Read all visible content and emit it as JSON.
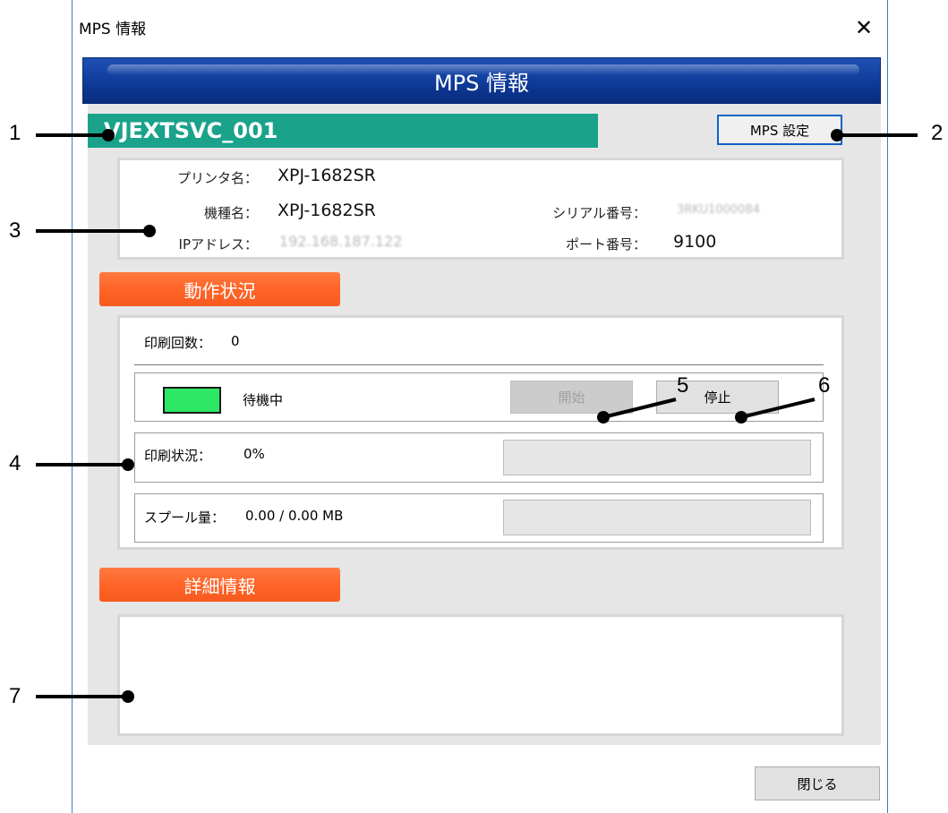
{
  "window": {
    "title": "MPS 情報",
    "close_glyph": "✕"
  },
  "banner": {
    "title": "MPS 情報"
  },
  "device": {
    "name": "VJEXTSVC_001",
    "settings_button": "MPS 設定"
  },
  "info": {
    "printer_name_label": "プリンタ名：",
    "printer_name": "XPJ-1682SR",
    "model_label": "機種名：",
    "model": "XPJ-1682SR",
    "ip_label": "IPアドレス：",
    "ip": "192.168.187.122",
    "serial_label": "シリアル番号：",
    "serial": "3RKU1000084",
    "port_label": "ポート番号：",
    "port": "9100"
  },
  "operation": {
    "header": "動作状況",
    "print_count_label": "印刷回数：",
    "print_count": "0",
    "status_text": "待機中",
    "status_color": "#2ee865",
    "start_button": "開始",
    "stop_button": "停止",
    "print_status_label": "印刷状況：",
    "print_status_value": "0%",
    "print_progress": 0,
    "spool_label": "スプール量：",
    "spool_value": "0.00 / 0.00 MB",
    "spool_progress": 0
  },
  "details": {
    "header": "詳細情報"
  },
  "footer": {
    "close_button": "閉じる"
  },
  "callouts": [
    "1",
    "2",
    "3",
    "4",
    "5",
    "6",
    "7"
  ]
}
